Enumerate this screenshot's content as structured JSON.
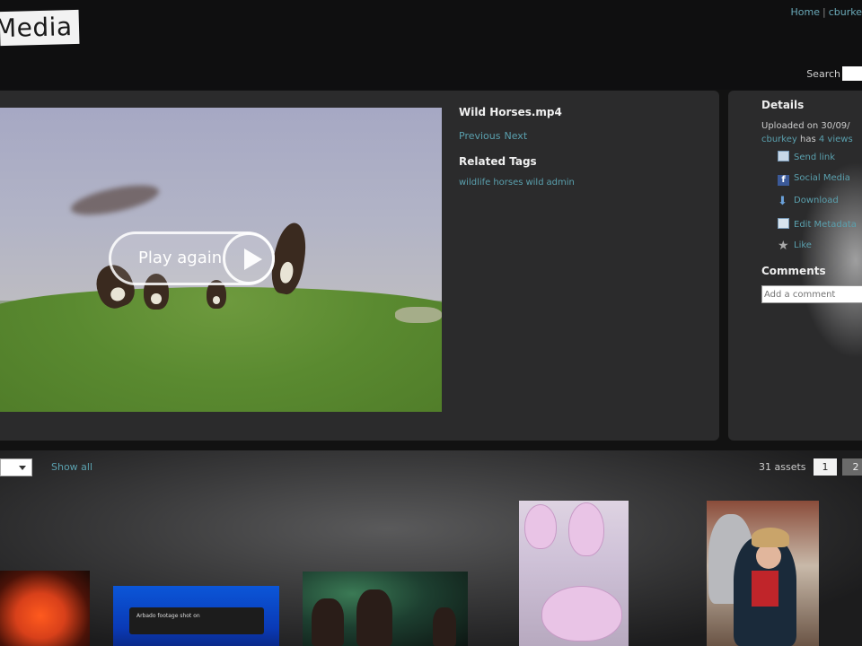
{
  "header": {
    "logo_text": "Media",
    "top_links": [
      "Home",
      "cburke"
    ],
    "top_sep": "|",
    "search_label": "Search"
  },
  "player": {
    "overlay_label": "Play again",
    "video_title": "Wild Horses.mp4",
    "nav": [
      "Previous",
      "Next"
    ],
    "related_heading": "Related Tags",
    "tags": [
      "wildlife",
      "horses",
      "wild",
      "admin"
    ]
  },
  "details": {
    "heading": "Details",
    "uploaded_text": "Uploaded on 30/09/",
    "uploader": "cburkey",
    "has_text": "has",
    "views_text": "4 views",
    "actions": [
      "Send link",
      "Social Media",
      "Download",
      "Edit Metadata",
      "Like"
    ],
    "comments_heading": "Comments",
    "comment_placeholder": "Add a comment"
  },
  "gallery": {
    "show_all": "Show all",
    "assets_count": "31 assets",
    "pages": [
      "1",
      "2"
    ],
    "thumb2_caption": "Arbado footage shot on"
  },
  "colors": {
    "link": "#5aa0ae",
    "panel": "#2b2b2c",
    "background": "#121212"
  }
}
